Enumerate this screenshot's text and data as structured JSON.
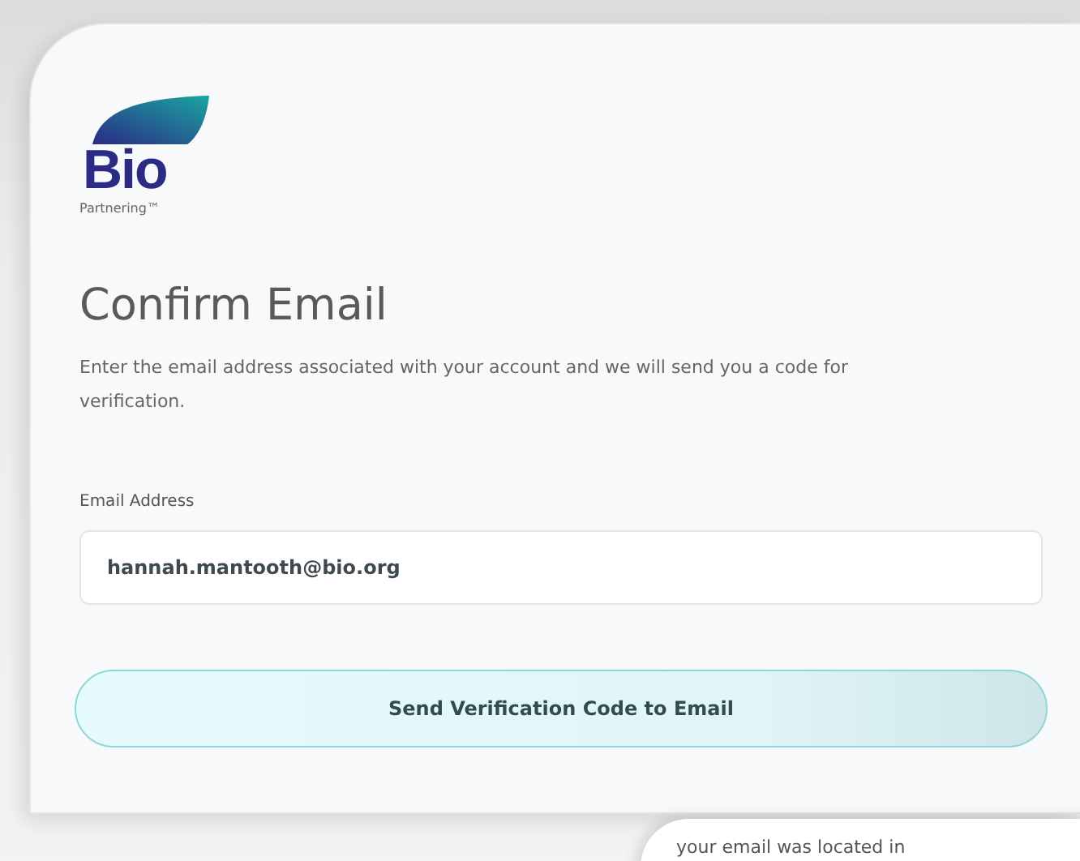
{
  "logo": {
    "name": "Bio",
    "tagline": "Partnering™"
  },
  "title": "Confirm Email",
  "description": "Enter the email address associated with your account and we will send you a code for verification.",
  "email_field": {
    "label": "Email Address",
    "value": "hannah.mantooth@bio.org"
  },
  "submit_button": "Send Verification Code to Email",
  "next_card": {
    "text": "your email was located in"
  }
}
